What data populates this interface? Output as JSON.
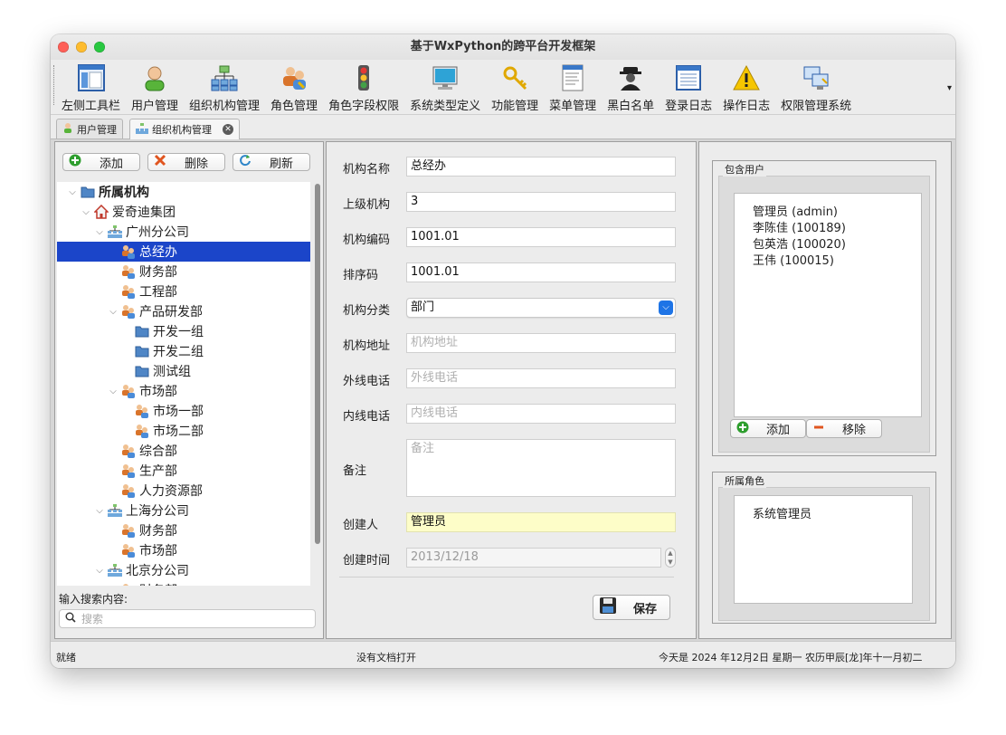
{
  "window": {
    "title": "基于WxPython的跨平台开发框架"
  },
  "toolbar": {
    "items": [
      {
        "label": "左侧工具栏",
        "icon": "left-toolbar-icon"
      },
      {
        "label": "用户管理",
        "icon": "user-icon"
      },
      {
        "label": "组织机构管理",
        "icon": "org-chart-icon"
      },
      {
        "label": "角色管理",
        "icon": "role-users-icon"
      },
      {
        "label": "角色字段权限",
        "icon": "traffic-light-icon"
      },
      {
        "label": "系统类型定义",
        "icon": "monitor-icon"
      },
      {
        "label": "功能管理",
        "icon": "keys-icon"
      },
      {
        "label": "菜单管理",
        "icon": "menu-document-icon"
      },
      {
        "label": "黑白名单",
        "icon": "spy-icon"
      },
      {
        "label": "登录日志",
        "icon": "log-list-icon"
      },
      {
        "label": "操作日志",
        "icon": "warning-icon"
      },
      {
        "label": "权限管理系统",
        "icon": "computers-icon"
      }
    ],
    "overflow": "▾"
  },
  "tabs": [
    {
      "label": "用户管理",
      "icon": "user-icon"
    },
    {
      "label": "组织机构管理",
      "icon": "org-chart-icon",
      "active": true
    }
  ],
  "left": {
    "buttons": {
      "add": "添加",
      "delete": "删除",
      "refresh": "刷新"
    },
    "tree": [
      {
        "label": "所属机构",
        "level": 0,
        "expanded": true,
        "icon": "folder",
        "bold": true
      },
      {
        "label": "爱奇迪集团",
        "level": 1,
        "expanded": true,
        "icon": "home"
      },
      {
        "label": "广州分公司",
        "level": 2,
        "expanded": true,
        "icon": "org"
      },
      {
        "label": "总经办",
        "level": 3,
        "icon": "group",
        "selected": true
      },
      {
        "label": "财务部",
        "level": 3,
        "icon": "group"
      },
      {
        "label": "工程部",
        "level": 3,
        "icon": "group"
      },
      {
        "label": "产品研发部",
        "level": 3,
        "expanded": true,
        "icon": "group"
      },
      {
        "label": "开发一组",
        "level": 4,
        "icon": "folder"
      },
      {
        "label": "开发二组",
        "level": 4,
        "icon": "folder"
      },
      {
        "label": "测试组",
        "level": 4,
        "icon": "folder"
      },
      {
        "label": "市场部",
        "level": 3,
        "expanded": true,
        "icon": "group"
      },
      {
        "label": "市场一部",
        "level": 4,
        "icon": "group"
      },
      {
        "label": "市场二部",
        "level": 4,
        "icon": "group"
      },
      {
        "label": "综合部",
        "level": 3,
        "icon": "group"
      },
      {
        "label": "生产部",
        "level": 3,
        "icon": "group"
      },
      {
        "label": "人力资源部",
        "level": 3,
        "icon": "group"
      },
      {
        "label": "上海分公司",
        "level": 2,
        "expanded": true,
        "icon": "org"
      },
      {
        "label": "财务部",
        "level": 3,
        "icon": "group"
      },
      {
        "label": "市场部",
        "level": 3,
        "icon": "group"
      },
      {
        "label": "北京分公司",
        "level": 2,
        "expanded": true,
        "icon": "org"
      },
      {
        "label": "财务部",
        "level": 3,
        "icon": "group"
      }
    ],
    "search": {
      "label": "输入搜索内容:",
      "placeholder": "搜索"
    }
  },
  "form": {
    "fields": [
      {
        "label": "机构名称",
        "value": "总经办",
        "placeholder": ""
      },
      {
        "label": "上级机构",
        "value": "3",
        "placeholder": ""
      },
      {
        "label": "机构编码",
        "value": "1001.01",
        "placeholder": ""
      },
      {
        "label": "排序码",
        "value": "1001.01",
        "placeholder": ""
      },
      {
        "label": "机构分类",
        "value": "部门",
        "placeholder": "",
        "type": "select"
      },
      {
        "label": "机构地址",
        "value": "",
        "placeholder": "机构地址"
      },
      {
        "label": "外线电话",
        "value": "",
        "placeholder": "外线电话"
      },
      {
        "label": "内线电话",
        "value": "",
        "placeholder": "内线电话"
      },
      {
        "label": "备注",
        "value": "",
        "placeholder": "备注",
        "type": "textarea"
      },
      {
        "label": "创建人",
        "value": "管理员",
        "placeholder": "",
        "readonly": true
      },
      {
        "label": "创建时间",
        "value": "2013/12/18",
        "placeholder": "",
        "type": "date"
      }
    ],
    "save_label": "保存"
  },
  "right": {
    "users_group": {
      "title": "包含用户",
      "users": [
        "管理员 (admin)",
        "李陈佳 (100189)",
        "包英浩 (100020)",
        "王伟 (100015)"
      ],
      "add_label": "添加",
      "remove_label": "移除"
    },
    "roles_group": {
      "title": "所属角色",
      "roles": [
        "系统管理员"
      ]
    }
  },
  "status": {
    "left": "就绪",
    "center": "没有文档打开",
    "right": "今天是 2024 年12月2日 星期一 农历甲辰[龙]年十一月初二"
  },
  "colors": {
    "selection": "#1b45c9",
    "readonly_field": "#fdfdc8",
    "close_light": "#fe5f57",
    "minimize_light": "#febc2e",
    "zoom_light": "#28c840"
  }
}
